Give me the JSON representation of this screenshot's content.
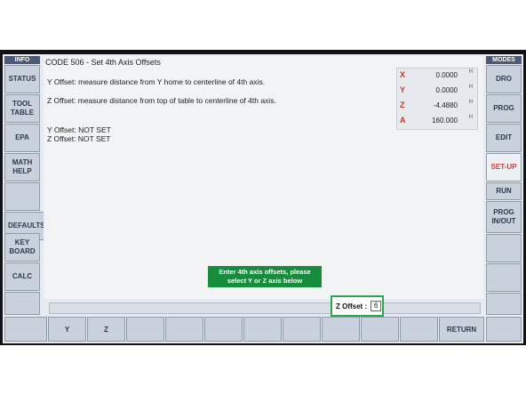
{
  "left_panel": {
    "header": "INFO",
    "buttons": [
      "STATUS",
      "TOOL\nTABLE",
      "EPA",
      "MATH\nHELP",
      "",
      "DEFAULTS",
      "KEY\nBOARD",
      "CALC"
    ]
  },
  "right_panel": {
    "header": "MODES",
    "buttons": [
      "DRO",
      "PROG",
      "EDIT",
      "SET-UP",
      "RUN",
      "PROG\nIN/OUT",
      "",
      ""
    ],
    "active": "SET-UP",
    "active_color": "#d23a3a"
  },
  "main": {
    "code_title": "CODE 506 - Set 4th Axis Offsets",
    "y_instruction": "Y Offset: measure distance from Y home to centerline of 4th axis.",
    "z_instruction": "Z Offset: measure distance from top of table to centerline of 4th axis.",
    "y_status": "Y Offset: NOT SET",
    "z_status": "Z Offset: NOT SET",
    "message": "Enter 4th axis offsets, please\nselect Y or Z axis below",
    "message_color": "#168c3c"
  },
  "coordinates": [
    {
      "axis": "X",
      "value": "0.0000",
      "unit": "H"
    },
    {
      "axis": "Y",
      "value": "0.0000",
      "unit": "H"
    },
    {
      "axis": "Z",
      "value": "-4.4880",
      "unit": "H"
    },
    {
      "axis": "A",
      "value": "160.000",
      "unit": "H"
    }
  ],
  "input": {
    "label": "Z Offset :",
    "value": "6",
    "border_color": "#2ba84a"
  },
  "softkeys": [
    "",
    "Y",
    "Z",
    "",
    "",
    "",
    "",
    "",
    "",
    "",
    "",
    "RETURN"
  ]
}
